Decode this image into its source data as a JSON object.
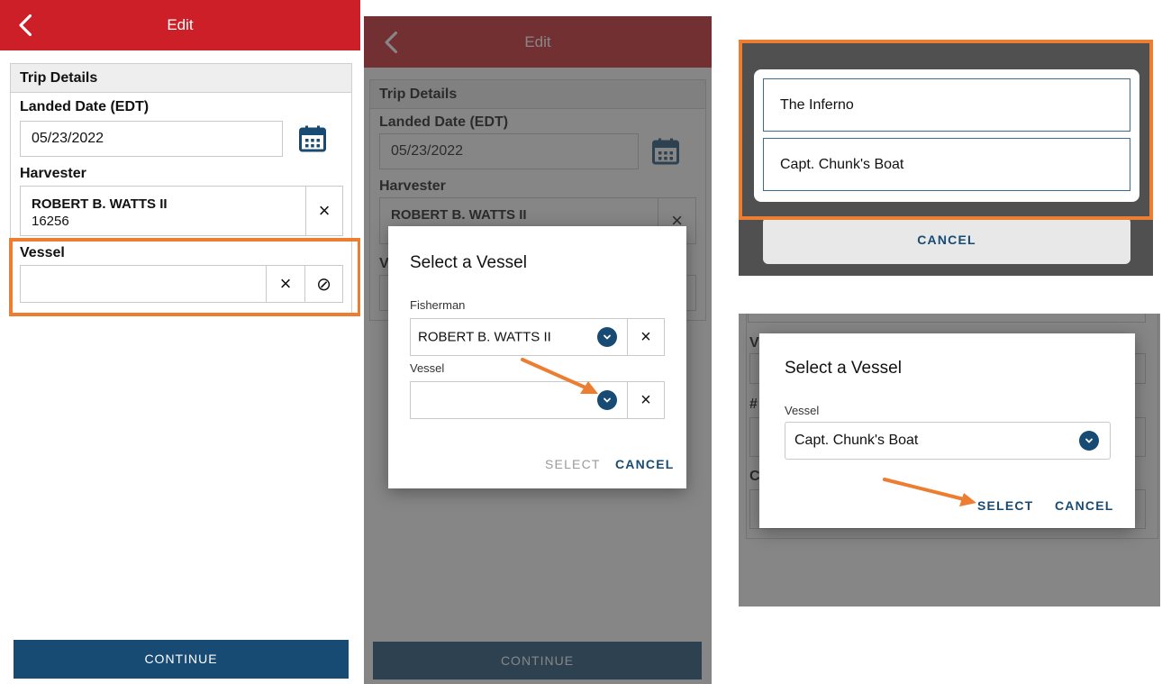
{
  "header": {
    "title": "Edit"
  },
  "trip": {
    "section_title": "Trip Details",
    "landed_date_label": "Landed Date (EDT)",
    "landed_date_value": "05/23/2022",
    "harvester_label": "Harvester",
    "harvester_name": "ROBERT B. WATTS II",
    "harvester_id": "16256",
    "vessel_label": "Vessel",
    "vessel_value": "",
    "clear_glyph": "×",
    "block_glyph": "⊘"
  },
  "continue_label": "CONTINUE",
  "dialog_fisherman": {
    "title": "Select a Vessel",
    "fisherman_label": "Fisherman",
    "fisherman_value": "ROBERT B. WATTS II",
    "vessel_label": "Vessel",
    "vessel_value": "",
    "select_label": "SELECT",
    "cancel_label": "CANCEL"
  },
  "vessel_list": {
    "items": [
      "The Inferno",
      "Capt. Chunk's Boat"
    ],
    "cancel_label": "CANCEL"
  },
  "dialog_vessel": {
    "title": "Select a Vessel",
    "vessel_label": "Vessel",
    "vessel_value": "Capt. Chunk's Boat",
    "select_label": "SELECT",
    "cancel_label": "CANCEL"
  },
  "colors": {
    "header_red": "#cc1f27",
    "primary_blue": "#184b73",
    "highlight_orange": "#ed7d31"
  }
}
